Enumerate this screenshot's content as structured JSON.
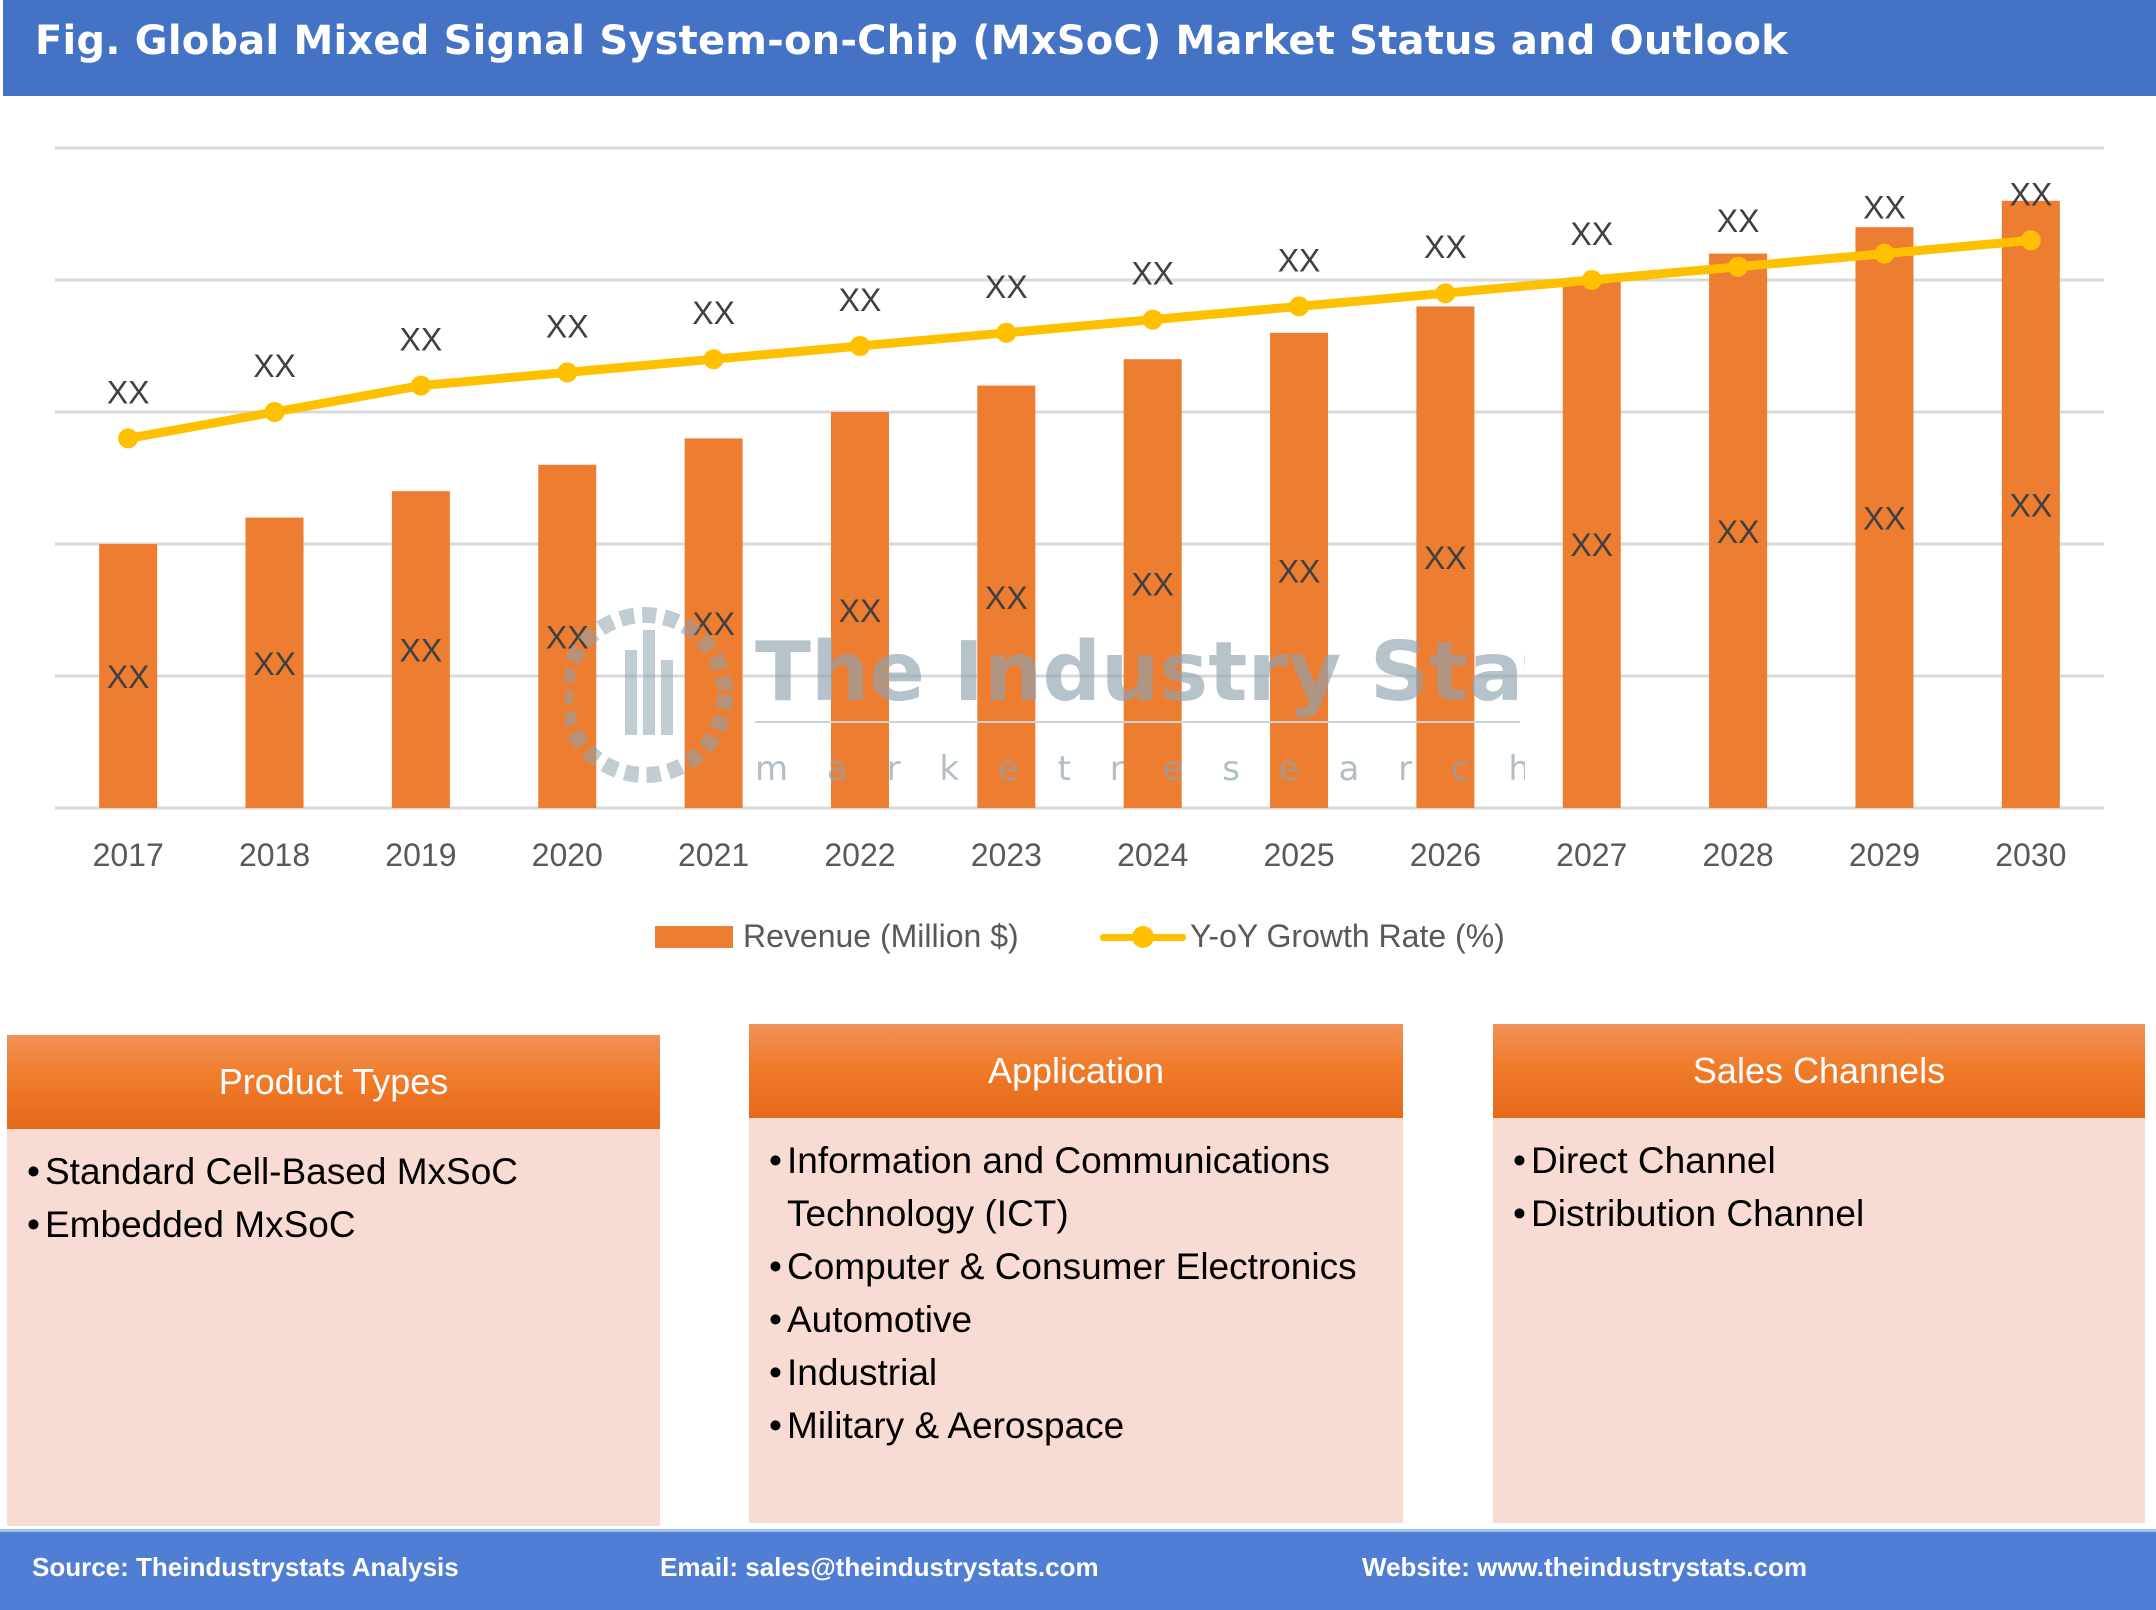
{
  "title": "Fig. Global Mixed Signal System-on-Chip (MxSoC) Market Status and Outlook",
  "chart_data": {
    "type": "bar",
    "title": "Fig. Global Mixed Signal System-on-Chip (MxSoC) Market Status and Outlook",
    "xlabel": "",
    "ylabel": "",
    "categories": [
      "2017",
      "2018",
      "2019",
      "2020",
      "2021",
      "2022",
      "2023",
      "2024",
      "2025",
      "2026",
      "2027",
      "2028",
      "2029",
      "2030"
    ],
    "grid": true,
    "legend_position": "bottom",
    "ylim": [
      0,
      5
    ],
    "series": [
      {
        "name": "Revenue (Million $)",
        "type": "bar",
        "color": "#ED7D31",
        "values": [
          2.0,
          2.2,
          2.4,
          2.6,
          2.8,
          3.0,
          3.2,
          3.4,
          3.6,
          3.8,
          4.0,
          4.2,
          4.4,
          4.6
        ],
        "data_labels": [
          "XX",
          "XX",
          "XX",
          "XX",
          "XX",
          "XX",
          "XX",
          "XX",
          "XX",
          "XX",
          "XX",
          "XX",
          "XX",
          "XX"
        ]
      },
      {
        "name": "Y-oY Growth Rate (%)",
        "type": "line",
        "color": "#FFC000",
        "values": [
          2.8,
          3.0,
          3.2,
          3.3,
          3.4,
          3.5,
          3.6,
          3.7,
          3.8,
          3.9,
          4.0,
          4.1,
          4.2,
          4.3
        ],
        "data_labels": [
          "XX",
          "XX",
          "XX",
          "XX",
          "XX",
          "XX",
          "XX",
          "XX",
          "XX",
          "XX",
          "XX",
          "XX",
          "XX",
          "XX"
        ]
      }
    ]
  },
  "watermark": {
    "name": "The Industry Stats",
    "tagline": "m a r k e t   r e s e a r c h"
  },
  "boxes": [
    {
      "title": "Product Types",
      "items": [
        "Standard Cell-Based MxSoC",
        "Embedded MxSoC"
      ]
    },
    {
      "title": "Application",
      "items": [
        "Information and Communications Technology (ICT)",
        "Computer & Consumer Electronics",
        "Automotive",
        "Industrial",
        "Military & Aerospace"
      ]
    },
    {
      "title": "Sales Channels",
      "items": [
        "Direct Channel",
        "Distribution Channel"
      ]
    }
  ],
  "footer": {
    "source": "Source: Theindustrystats Analysis",
    "email": "Email: sales@theindustrystats.com",
    "website": "Website: www.theindustrystats.com"
  },
  "colors": {
    "header_blue": "#4472C4",
    "bar_orange": "#ED7D31",
    "line_yellow": "#FFC000",
    "box_fill": "#F8DBD2",
    "footer_blue": "#4F7ED4"
  }
}
